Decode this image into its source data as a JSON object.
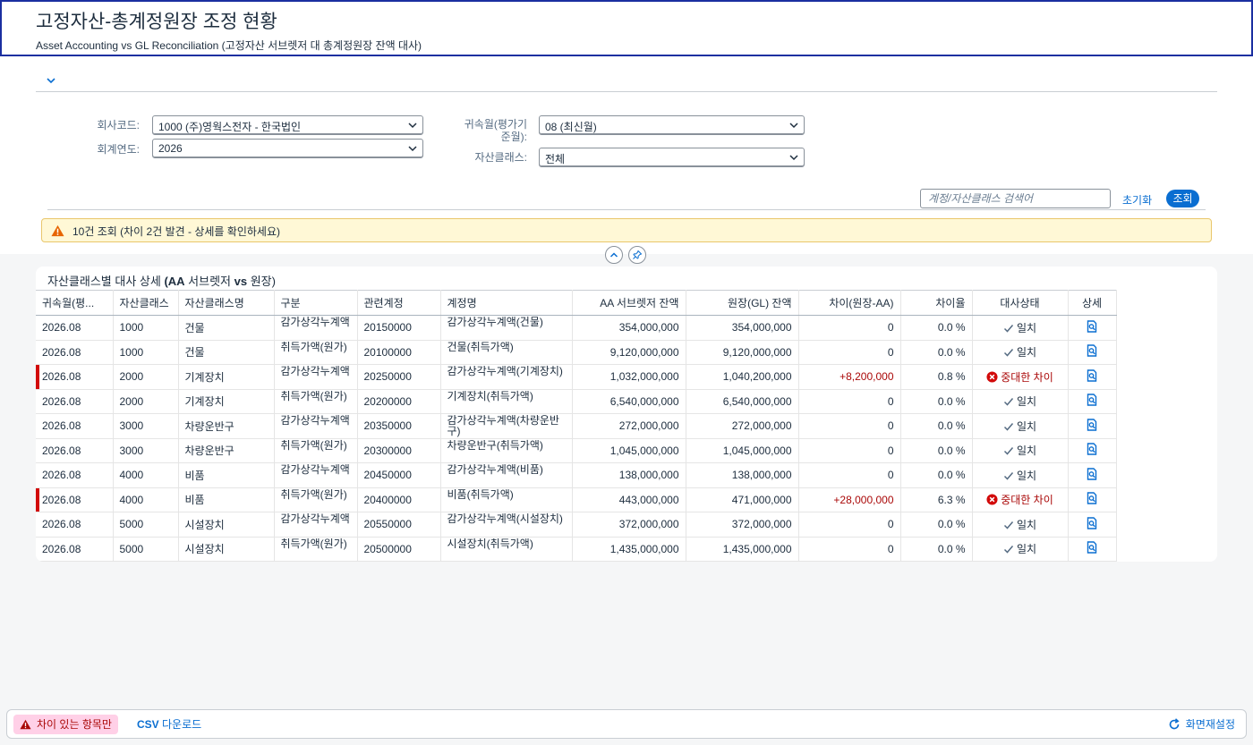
{
  "header": {
    "title": "고정자산-총계정원장 조정 현황",
    "subtitle": "Asset Accounting vs GL Reconciliation (고정자산 서브렛저 대 총계정원장 잔액 대사)"
  },
  "filters": {
    "company_label": "회사코드:",
    "company_value": "1000 (주)영웍스전자 - 한국법인",
    "year_label": "회계연도:",
    "year_value": "2026",
    "period_label_1": "귀속월(평가기",
    "period_label_2": "준월):",
    "period_value": "08 (최신월)",
    "class_label": "자산클래스:",
    "class_value": "전체",
    "search_placeholder": "계정/자산클래스 검색어",
    "reset_label": "초기화",
    "go_label": "조회"
  },
  "message": {
    "text": "10건 조회 (차이 2건 발견 - 상세를 확인하세요)",
    "type": "warning"
  },
  "table": {
    "title_pre": "자산클래스별 대사 상세 ",
    "title_b1": "(AA",
    "title_mid": " 서브렛저 ",
    "title_b2": "vs",
    "title_post": " 원장)",
    "columns": [
      "귀속월(평...",
      "자산클래스",
      "자산클래스명",
      "구분",
      "관련계정",
      "계정명",
      "AA 서브렛저 잔액",
      "원장(GL) 잔액",
      "차이(원장-AA)",
      "차이율",
      "대사상태",
      "상세"
    ],
    "rows": [
      {
        "period": "2026.08",
        "class": "1000",
        "class_name": "건물",
        "type": "감가상각누계액",
        "account": "20150000",
        "account_name": "감가상각누계액(건물)",
        "aa": "354,000,000",
        "gl": "354,000,000",
        "diff": "0",
        "rate": "0.0 %",
        "status": "일치",
        "error": false
      },
      {
        "period": "2026.08",
        "class": "1000",
        "class_name": "건물",
        "type": "취득가액(원가)",
        "account": "20100000",
        "account_name": "건물(취득가액)",
        "aa": "9,120,000,000",
        "gl": "9,120,000,000",
        "diff": "0",
        "rate": "0.0 %",
        "status": "일치",
        "error": false
      },
      {
        "period": "2026.08",
        "class": "2000",
        "class_name": "기계장치",
        "type": "감가상각누계액",
        "account": "20250000",
        "account_name": "감가상각누계액(기계장치)",
        "aa": "1,032,000,000",
        "gl": "1,040,200,000",
        "diff": "+8,200,000",
        "rate": "0.8 %",
        "status": "중대한 차이",
        "error": true
      },
      {
        "period": "2026.08",
        "class": "2000",
        "class_name": "기계장치",
        "type": "취득가액(원가)",
        "account": "20200000",
        "account_name": "기계장치(취득가액)",
        "aa": "6,540,000,000",
        "gl": "6,540,000,000",
        "diff": "0",
        "rate": "0.0 %",
        "status": "일치",
        "error": false
      },
      {
        "period": "2026.08",
        "class": "3000",
        "class_name": "차량운반구",
        "type": "감가상각누계액",
        "account": "20350000",
        "account_name": "감가상각누계액(차량운반구)",
        "aa": "272,000,000",
        "gl": "272,000,000",
        "diff": "0",
        "rate": "0.0 %",
        "status": "일치",
        "error": false
      },
      {
        "period": "2026.08",
        "class": "3000",
        "class_name": "차량운반구",
        "type": "취득가액(원가)",
        "account": "20300000",
        "account_name": "차량운반구(취득가액)",
        "aa": "1,045,000,000",
        "gl": "1,045,000,000",
        "diff": "0",
        "rate": "0.0 %",
        "status": "일치",
        "error": false
      },
      {
        "period": "2026.08",
        "class": "4000",
        "class_name": "비품",
        "type": "감가상각누계액",
        "account": "20450000",
        "account_name": "감가상각누계액(비품)",
        "aa": "138,000,000",
        "gl": "138,000,000",
        "diff": "0",
        "rate": "0.0 %",
        "status": "일치",
        "error": false
      },
      {
        "period": "2026.08",
        "class": "4000",
        "class_name": "비품",
        "type": "취득가액(원가)",
        "account": "20400000",
        "account_name": "비품(취득가액)",
        "aa": "443,000,000",
        "gl": "471,000,000",
        "diff": "+28,000,000",
        "rate": "6.3 %",
        "status": "중대한 차이",
        "error": true
      },
      {
        "period": "2026.08",
        "class": "5000",
        "class_name": "시설장치",
        "type": "감가상각누계액",
        "account": "20550000",
        "account_name": "감가상각누계액(시설장치)",
        "aa": "372,000,000",
        "gl": "372,000,000",
        "diff": "0",
        "rate": "0.0 %",
        "status": "일치",
        "error": false
      },
      {
        "period": "2026.08",
        "class": "5000",
        "class_name": "시설장치",
        "type": "취득가액(원가)",
        "account": "20500000",
        "account_name": "시설장치(취득가액)",
        "aa": "1,435,000,000",
        "gl": "1,435,000,000",
        "diff": "0",
        "rate": "0.0 %",
        "status": "일치",
        "error": false
      }
    ]
  },
  "footer": {
    "diff_only_label": "차이 있는 항목만",
    "csv_b": "CSV",
    "csv_rest": " 다운로드",
    "refresh_label": "화면재설정"
  },
  "colors": {
    "accent": "#0a6ed1",
    "error": "#aa0808",
    "error_bar": "#d20a0a",
    "warning_bg": "#fff8d6"
  }
}
